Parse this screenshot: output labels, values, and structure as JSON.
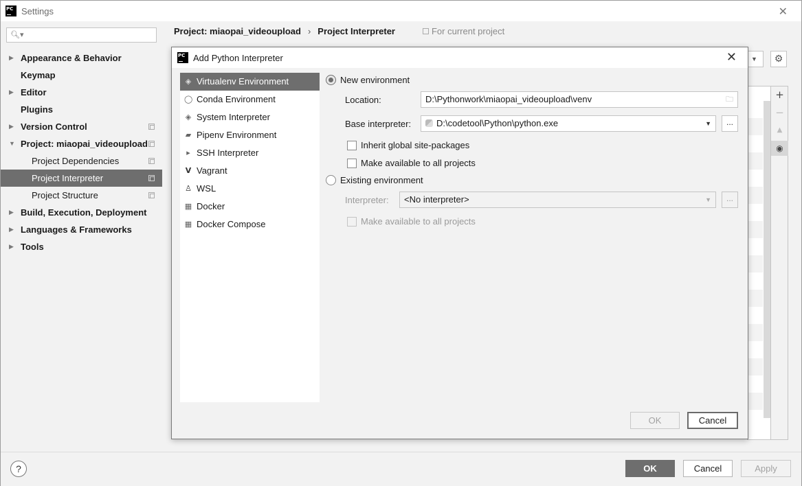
{
  "window": {
    "title": "Settings"
  },
  "search": {
    "placeholder": ""
  },
  "sidebar": {
    "items": [
      {
        "label": "Appearance & Behavior"
      },
      {
        "label": "Keymap"
      },
      {
        "label": "Editor"
      },
      {
        "label": "Plugins"
      },
      {
        "label": "Version Control"
      },
      {
        "label": "Project: miaopai_videoupload"
      },
      {
        "label": "Project Dependencies"
      },
      {
        "label": "Project Interpreter"
      },
      {
        "label": "Project Structure"
      },
      {
        "label": "Build, Execution, Deployment"
      },
      {
        "label": "Languages & Frameworks"
      },
      {
        "label": "Tools"
      }
    ]
  },
  "breadcrumb": {
    "project": "Project: miaopai_videoupload",
    "separator": "›",
    "page": "Project Interpreter",
    "note": "For current project"
  },
  "toolbar_side": {
    "add": "+",
    "remove": "−",
    "up": "▲",
    "eye": "◉"
  },
  "dialog": {
    "title": "Add Python Interpreter",
    "env_types": [
      {
        "label": "Virtualenv Environment",
        "icon": "virtualenv-icon"
      },
      {
        "label": "Conda Environment",
        "icon": "conda-icon"
      },
      {
        "label": "System Interpreter",
        "icon": "python-icon"
      },
      {
        "label": "Pipenv Environment",
        "icon": "pipenv-icon"
      },
      {
        "label": "SSH Interpreter",
        "icon": "ssh-icon"
      },
      {
        "label": "Vagrant",
        "icon": "vagrant-icon"
      },
      {
        "label": "WSL",
        "icon": "linux-icon"
      },
      {
        "label": "Docker",
        "icon": "docker-icon"
      },
      {
        "label": "Docker Compose",
        "icon": "docker-compose-icon"
      }
    ],
    "new_env": {
      "label": "New environment",
      "location_label": "Location:",
      "location_value": "D:\\Pythonwork\\miaopai_videoupload\\venv",
      "base_label": "Base interpreter:",
      "base_value": "D:\\codetool\\Python\\python.exe",
      "inherit_label": "Inherit global site-packages",
      "make_available_label": "Make available to all projects"
    },
    "existing_env": {
      "label": "Existing environment",
      "interpreter_label": "Interpreter:",
      "interpreter_value": "<No interpreter>",
      "make_available_label": "Make available to all projects"
    },
    "browse": "...",
    "ok": "OK",
    "cancel": "Cancel"
  },
  "footer": {
    "help": "?",
    "ok": "OK",
    "cancel": "Cancel",
    "apply": "Apply"
  }
}
